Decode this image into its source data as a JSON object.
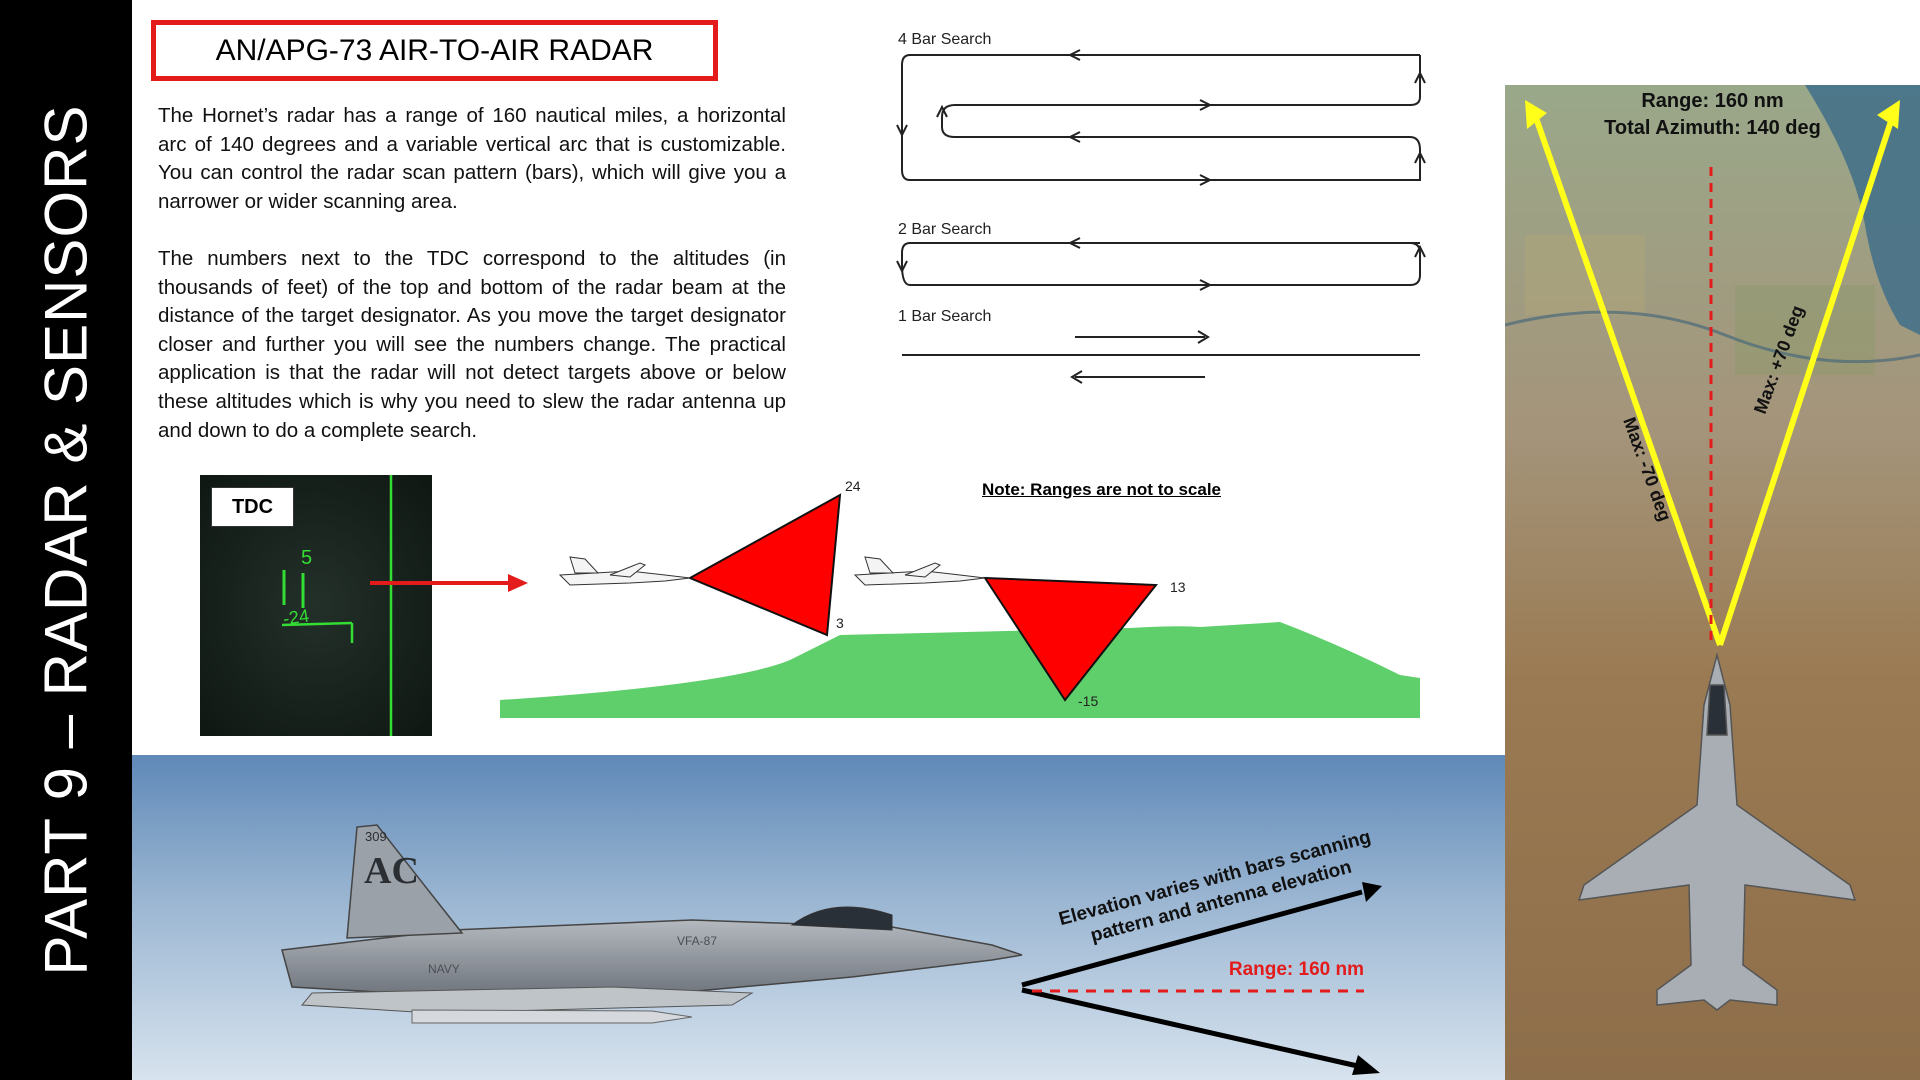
{
  "section": {
    "title": "PART 9 – RADAR & SENSORS"
  },
  "header": {
    "title": "AN/APG-73 AIR-TO-AIR RADAR"
  },
  "body": {
    "paragraph_1": "The Hornet’s radar has a range of 160 nautical miles, a horizontal arc of 140 degrees and a variable vertical arc that is customizable. You can control the radar scan pattern (bars), which will give you a narrower or wider scanning area.",
    "paragraph_2": "The numbers next to the TDC correspond to the altitudes (in thousands of feet) of the top and bottom of the radar beam at the distance of the target designator. As you move the target designator closer and further you will see the numbers change. The practical application is that the radar will not detect targets above or below these altitudes which is why you need to slew the radar antenna up and down to do a complete search."
  },
  "scan_patterns": {
    "four_bar_label": "4 Bar Search",
    "two_bar_label": "2 Bar Search",
    "one_bar_label": "1 Bar Search"
  },
  "tdc_inset": {
    "label": "TDC",
    "top_value": "5",
    "bottom_value": "-24"
  },
  "elevation_diagram": {
    "note": "Note: Ranges are not to scale",
    "far_top": "24",
    "far_bottom": "3",
    "near_top": "13",
    "near_bottom": "-15"
  },
  "side_view": {
    "elevation_line_1": "Elevation varies with bars scanning",
    "elevation_line_2": "pattern and antenna elevation",
    "range": "Range: 160 nm",
    "tail_code": "AC",
    "tail_number": "309",
    "squadron": "VFA-87",
    "fuselage_marking": "NAVY"
  },
  "top_view": {
    "range": "Range: 160 nm",
    "azimuth": "Total Azimuth: 140 deg",
    "left_limit": "Max: -70 deg",
    "right_limit": "Max: +70 deg"
  },
  "colors": {
    "accent_red": "#e31b1b",
    "terrain_green": "#5fcf6c",
    "beam_red": "#ff0000",
    "hud_green": "#33dd33",
    "arc_yellow": "#ffff1a"
  }
}
